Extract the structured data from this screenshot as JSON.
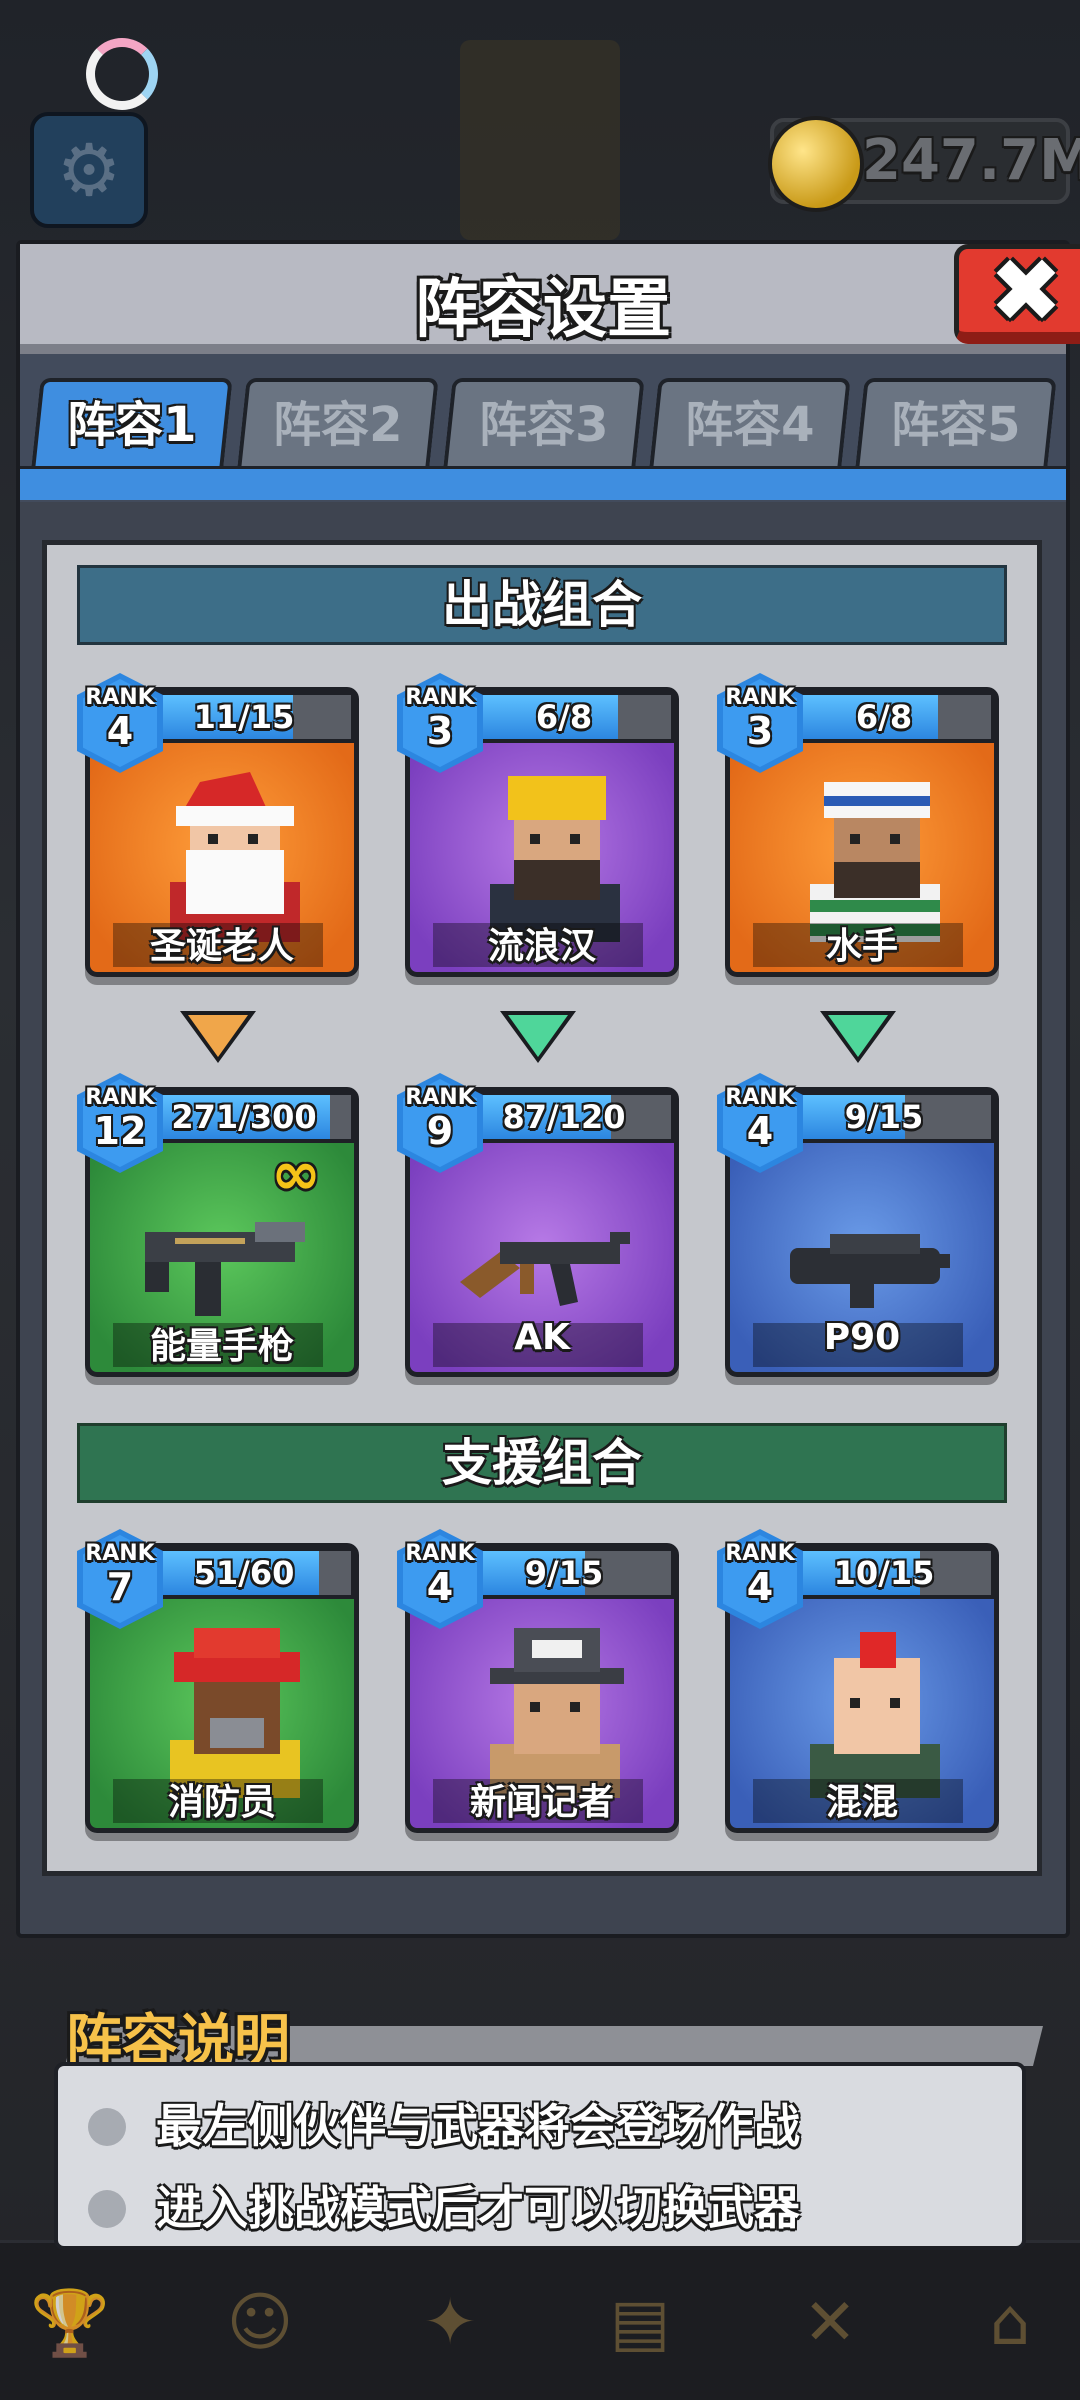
{
  "top_bar": {
    "coins": "247.7M"
  },
  "dialog": {
    "title": "阵容设置",
    "close_symbol": "✖",
    "tabs": [
      {
        "label": "阵容1",
        "active": true
      },
      {
        "label": "阵容2",
        "active": false
      },
      {
        "label": "阵容3",
        "active": false
      },
      {
        "label": "阵容4",
        "active": false
      },
      {
        "label": "阵容5",
        "active": false
      }
    ],
    "battle_section": {
      "title": "出战组合",
      "heroes": [
        {
          "name": "圣诞老人",
          "rank_word": "RANK",
          "rank": "4",
          "progress": "11/15",
          "color": "orange"
        },
        {
          "name": "流浪汉",
          "rank_word": "RANK",
          "rank": "3",
          "progress": "6/8",
          "color": "purple"
        },
        {
          "name": "水手",
          "rank_word": "RANK",
          "rank": "3",
          "progress": "6/8",
          "color": "orange"
        }
      ],
      "weapons": [
        {
          "name": "能量手枪",
          "rank_word": "RANK",
          "rank": "12",
          "progress": "271/300",
          "color": "green",
          "infinite_ammo": true
        },
        {
          "name": "AK",
          "rank_word": "RANK",
          "rank": "9",
          "progress": "87/120",
          "color": "purple"
        },
        {
          "name": "P90",
          "rank_word": "RANK",
          "rank": "4",
          "progress": "9/15",
          "color": "blue"
        }
      ]
    },
    "support_section": {
      "title": "支援组合",
      "heroes": [
        {
          "name": "消防员",
          "rank_word": "RANK",
          "rank": "7",
          "progress": "51/60",
          "color": "green"
        },
        {
          "name": "新闻记者",
          "rank_word": "RANK",
          "rank": "4",
          "progress": "9/15",
          "color": "purple"
        },
        {
          "name": "混混",
          "rank_word": "RANK",
          "rank": "4",
          "progress": "10/15",
          "color": "blue"
        }
      ]
    }
  },
  "description": {
    "title": "阵容说明",
    "lines": [
      "最左侧伙伴与武器将会登场作战",
      "进入挑战模式后才可以切换武器"
    ]
  },
  "colors": {
    "accent_blue": "#3f8ee0",
    "close_red": "#e23a2f",
    "title_gold": "#f7c24a"
  }
}
